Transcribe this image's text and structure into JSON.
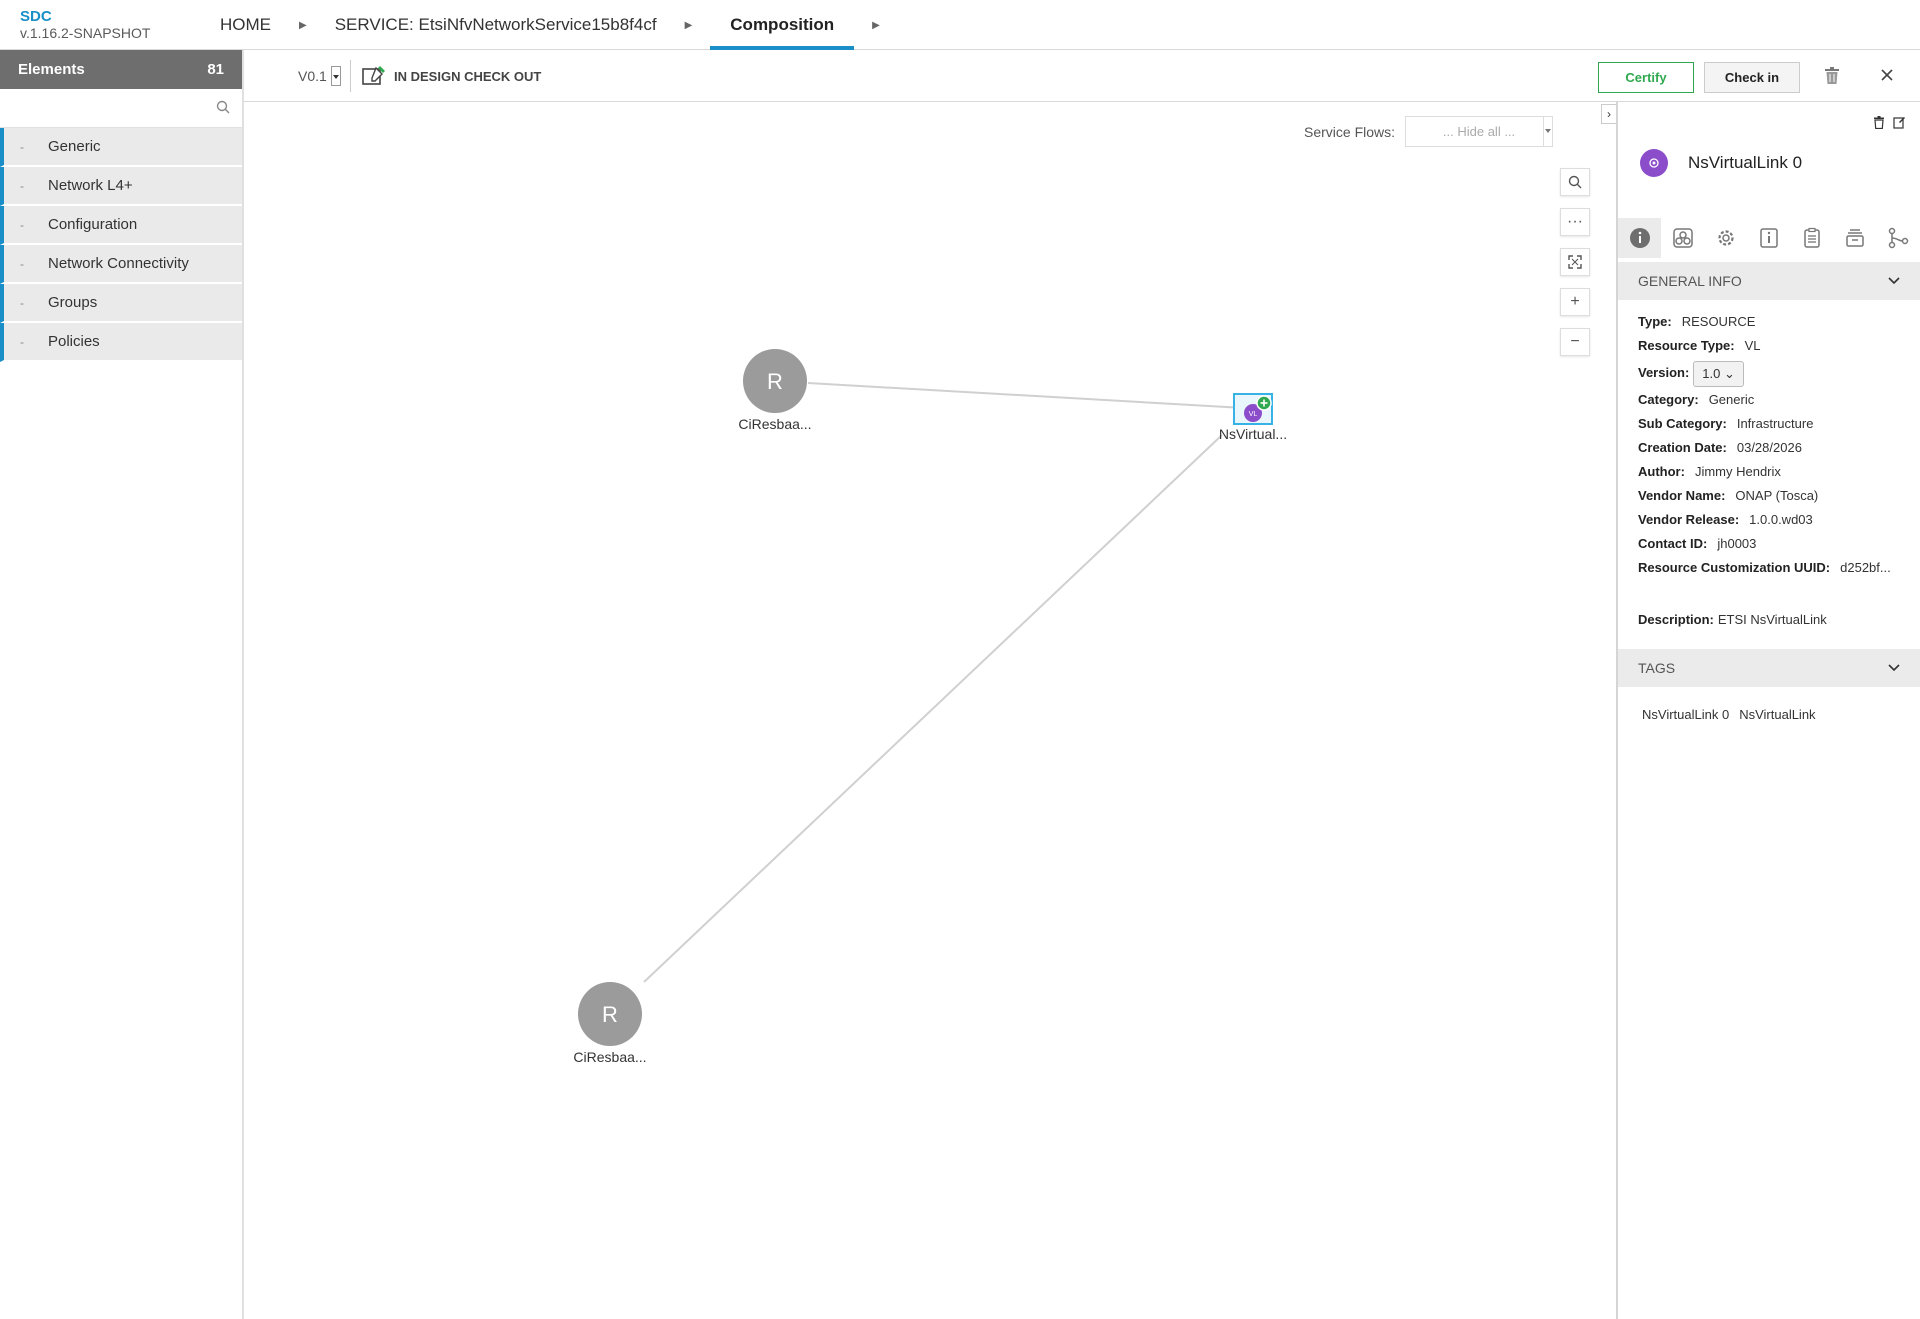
{
  "app": {
    "name": "SDC",
    "version": "v.1.16.2-SNAPSHOT"
  },
  "breadcrumbs": [
    {
      "label": "HOME"
    },
    {
      "label": "SERVICE: EtsiNfvNetworkService15b8f4cf"
    },
    {
      "label": "Composition"
    }
  ],
  "palette": {
    "title": "Elements",
    "count": "81",
    "search_placeholder": "",
    "groups": [
      {
        "label": "Generic"
      },
      {
        "label": "Network L4+"
      },
      {
        "label": "Configuration"
      },
      {
        "label": "Network Connectivity"
      },
      {
        "label": "Groups"
      },
      {
        "label": "Policies"
      }
    ]
  },
  "toolbar": {
    "version": "V0.1",
    "status": "IN DESIGN CHECK OUT",
    "certify_label": "Certify",
    "checkin_label": "Check in"
  },
  "canvas": {
    "service_flows_label": "Service Flows:",
    "service_flows_value": "... Hide all ...",
    "nodes": [
      {
        "initial": "R",
        "label": "CiResbaa..."
      },
      {
        "initial": "VL",
        "label": "NsVirtual..."
      },
      {
        "initial": "R",
        "label": "CiResbaa..."
      }
    ]
  },
  "panel": {
    "title": "NsVirtualLink 0",
    "general_info_header": "GENERAL INFO",
    "info": {
      "type_label": "Type:",
      "type_value": "RESOURCE",
      "resource_type_label": "Resource Type:",
      "resource_type_value": "VL",
      "version_label": "Version:",
      "version_value": "1.0",
      "category_label": "Category:",
      "category_value": "Generic",
      "sub_category_label": "Sub Category:",
      "sub_category_value": "Infrastructure",
      "creation_date_label": "Creation Date:",
      "creation_date_value": "03/28/2026",
      "author_label": "Author:",
      "author_value": "Jimmy Hendrix",
      "vendor_name_label": "Vendor Name:",
      "vendor_name_value": "ONAP (Tosca)",
      "vendor_release_label": "Vendor Release:",
      "vendor_release_value": "1.0.0.wd03",
      "contact_id_label": "Contact ID:",
      "contact_id_value": "jh0003",
      "uuid_label": "Resource Customization UUID:",
      "uuid_value": "d252bf...",
      "description_label": "Description:",
      "description_value": "ETSI NsVirtualLink"
    },
    "tags_header": "TAGS",
    "tags": [
      "NsVirtualLink 0",
      "NsVirtualLink"
    ]
  },
  "colors": {
    "accent": "#1a8fc7",
    "certify": "#2fa84f",
    "vl_node": "#8b4dc9",
    "resource_node": "#9b9b9b"
  }
}
